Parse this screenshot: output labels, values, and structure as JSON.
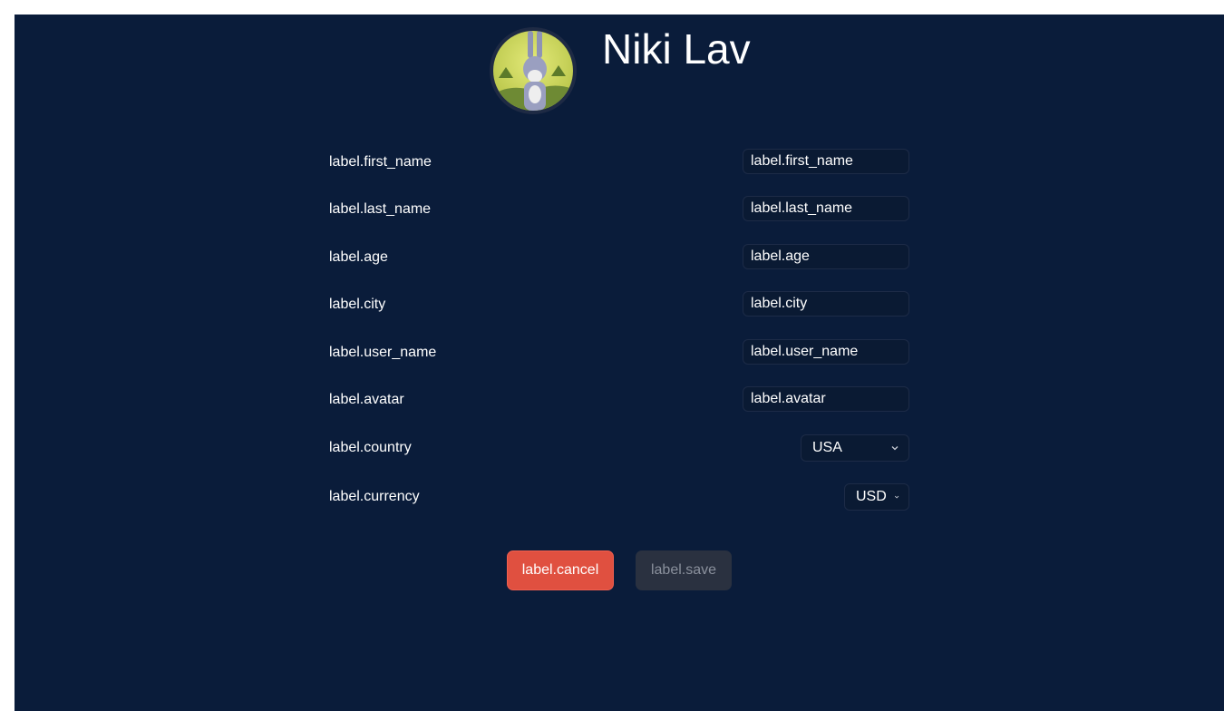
{
  "profile": {
    "display_name": "Niki Lav"
  },
  "form": {
    "first_name": {
      "label": "label.first_name",
      "placeholder": "label.first_name"
    },
    "last_name": {
      "label": "label.last_name",
      "placeholder": "label.last_name"
    },
    "age": {
      "label": "label.age",
      "placeholder": "label.age"
    },
    "city": {
      "label": "label.city",
      "placeholder": "label.city"
    },
    "user_name": {
      "label": "label.user_name",
      "placeholder": "label.user_name"
    },
    "avatar": {
      "label": "label.avatar",
      "placeholder": "label.avatar"
    },
    "country": {
      "label": "label.country",
      "value": "USA"
    },
    "currency": {
      "label": "label.currency",
      "value": "USD"
    }
  },
  "actions": {
    "cancel_label": "label.cancel",
    "save_label": "label.save"
  },
  "colors": {
    "background": "#0a1c3a",
    "cancel": "#e05040",
    "save_disabled": "#2a3140"
  },
  "icons": {
    "avatar": "profile-avatar-image",
    "select_chevron": "chevron-down-icon"
  }
}
